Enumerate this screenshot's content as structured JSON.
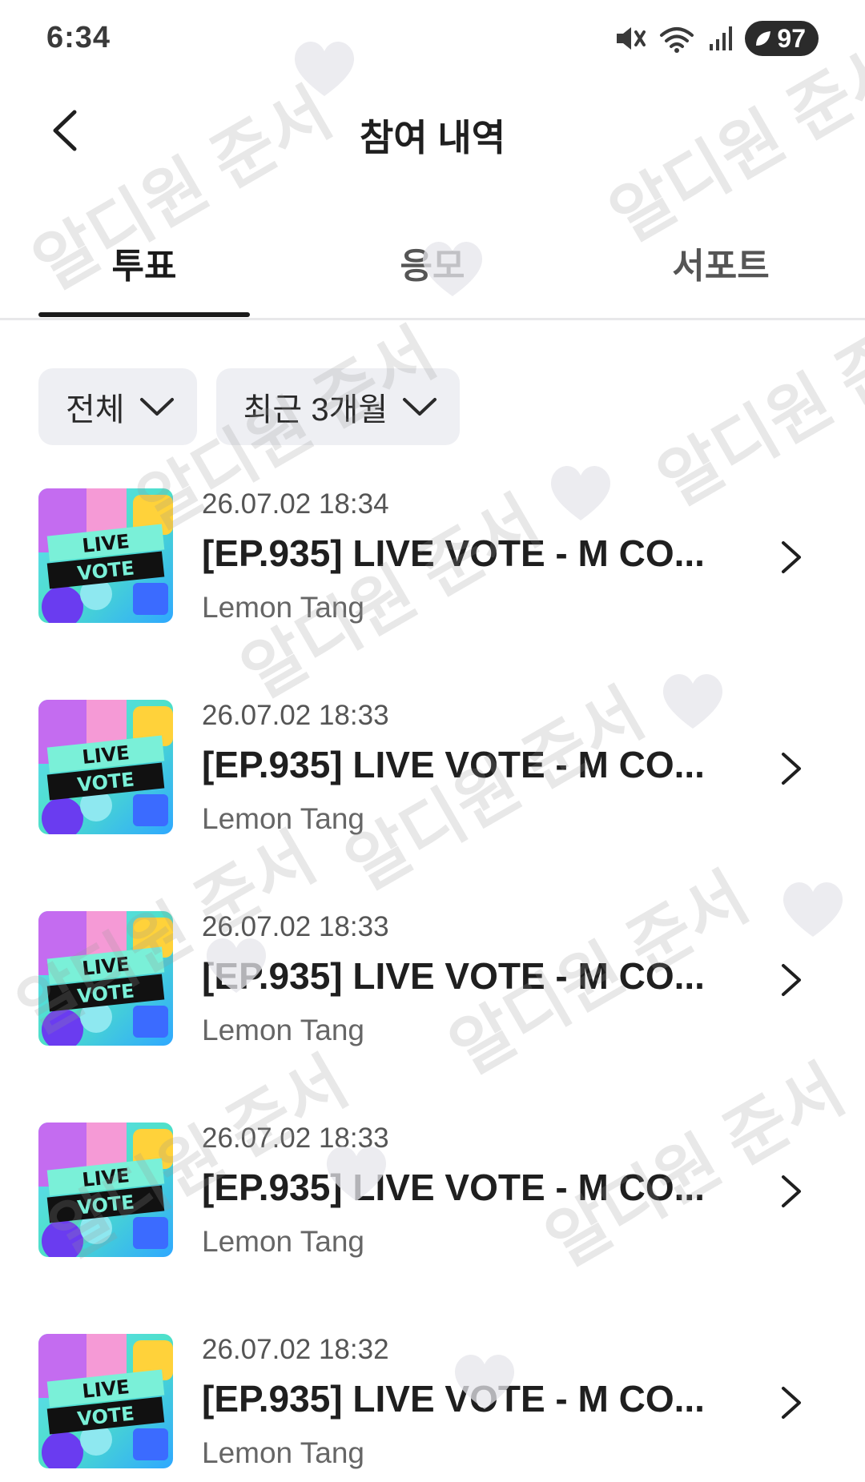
{
  "status_bar": {
    "time": "6:34",
    "battery": "97"
  },
  "header": {
    "title": "참여 내역"
  },
  "tabs": [
    {
      "label": "투표",
      "active": true
    },
    {
      "label": "응모",
      "active": false
    },
    {
      "label": "서포트",
      "active": false
    }
  ],
  "filters": {
    "category": "전체",
    "period": "최근 3개월"
  },
  "items": [
    {
      "date": "26.07.02 18:34",
      "title": "[EP.935] LIVE VOTE - M CO...",
      "org": "Lemon Tang"
    },
    {
      "date": "26.07.02 18:33",
      "title": "[EP.935] LIVE VOTE - M CO...",
      "org": "Lemon Tang"
    },
    {
      "date": "26.07.02 18:33",
      "title": "[EP.935] LIVE VOTE - M CO...",
      "org": "Lemon Tang"
    },
    {
      "date": "26.07.02 18:33",
      "title": "[EP.935] LIVE VOTE - M CO...",
      "org": "Lemon Tang"
    },
    {
      "date": "26.07.02 18:32",
      "title": "[EP.935] LIVE VOTE - M CO...",
      "org": "Lemon Tang"
    }
  ],
  "thumbnail_text": {
    "line1": "LIVE",
    "line2": "VOTE"
  },
  "watermark": {
    "text": "알디원 준서"
  },
  "icons": {
    "back": "chevron-left-icon",
    "dropdown": "chevron-down-icon",
    "row": "chevron-right-icon",
    "mute": "mute-icon",
    "wifi": "wifi-icon",
    "signal": "signal-icon"
  }
}
